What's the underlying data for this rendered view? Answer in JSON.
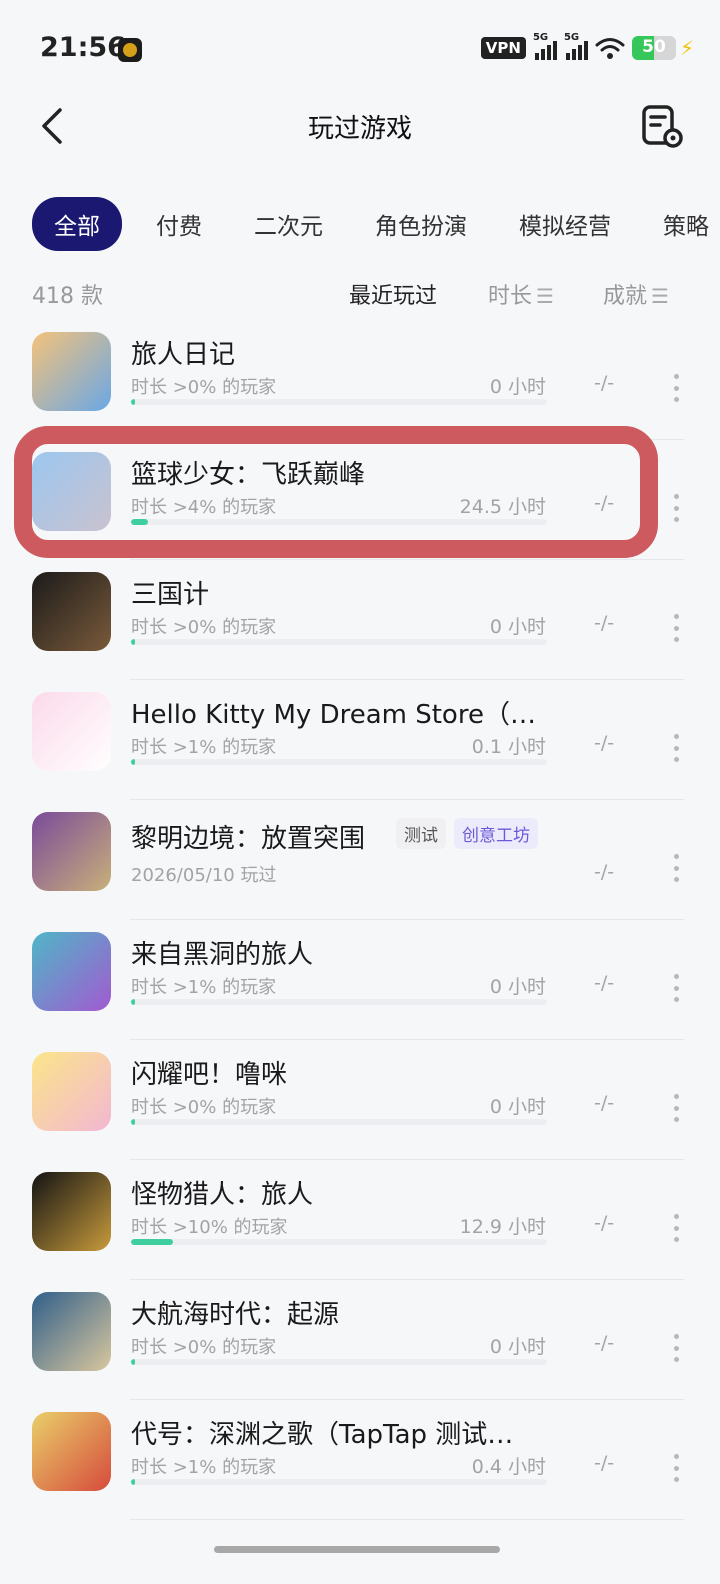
{
  "status": {
    "time": "21:56",
    "vpn": "VPN",
    "sig1": "5G",
    "sig2": "5G",
    "battery": "50"
  },
  "header": {
    "title": "玩过游戏"
  },
  "tabs": [
    "全部",
    "付费",
    "二次元",
    "角色扮演",
    "模拟经营",
    "策略"
  ],
  "sortbar": {
    "count": "418 款",
    "recent": "最近玩过",
    "duration": "时长",
    "achievement": "成就"
  },
  "games": [
    {
      "name": "旅人日记",
      "sub": "时长 >0% 的玩家",
      "hours": "0 小时",
      "ach": "-/-",
      "progress": 0.01,
      "icon": "game-icon-traveler-diary",
      "colors": [
        "#f4c27a",
        "#6aa7e6"
      ]
    },
    {
      "name": "篮球少女：飞跃巅峰",
      "sub": "时长 >4% 的玩家",
      "hours": "24.5 小时",
      "ach": "-/-",
      "progress": 0.04,
      "icon": "game-icon-basketball-girls",
      "colors": [
        "#9cc7f0",
        "#c9c2cf"
      ]
    },
    {
      "name": "三国计",
      "sub": "时长 >0% 的玩家",
      "hours": "0 小时",
      "ach": "-/-",
      "progress": 0.01,
      "icon": "game-icon-three-kingdoms",
      "colors": [
        "#1b1b1b",
        "#7a5a3a"
      ]
    },
    {
      "name": "Hello Kitty My Dream Store（…",
      "sub": "时长 >1% 的玩家",
      "hours": "0.1 小时",
      "ach": "-/-",
      "progress": 0.01,
      "icon": "game-icon-hello-kitty",
      "colors": [
        "#fbd9ea",
        "#ffffff"
      ]
    },
    {
      "name": "黎明边境：放置突围",
      "sub": "2026/05/10 玩过",
      "hours": "",
      "ach": "-/-",
      "progress": null,
      "badges": [
        "测试",
        "创意工坊"
      ],
      "icon": "game-icon-dawn-frontier",
      "colors": [
        "#7a4b9a",
        "#c8b07a"
      ]
    },
    {
      "name": "来自黑洞的旅人",
      "sub": "时长 >1% 的玩家",
      "hours": "0 小时",
      "ach": "-/-",
      "progress": 0.01,
      "icon": "game-icon-blackhole-traveler",
      "colors": [
        "#4fb6c7",
        "#a25ad0"
      ]
    },
    {
      "name": "闪耀吧！噜咪",
      "sub": "时长 >0% 的玩家",
      "hours": "0 小时",
      "ach": "-/-",
      "progress": 0.01,
      "icon": "game-icon-shine-lumi",
      "colors": [
        "#fbe58a",
        "#f3b7d2"
      ]
    },
    {
      "name": "怪物猎人：旅人",
      "sub": "时长 >10% 的玩家",
      "hours": "12.9 小时",
      "ach": "-/-",
      "progress": 0.1,
      "icon": "game-icon-monster-hunter",
      "colors": [
        "#141414",
        "#c89b3c"
      ]
    },
    {
      "name": "大航海时代：起源",
      "sub": "时长 >0% 的玩家",
      "hours": "0 小时",
      "ach": "-/-",
      "progress": 0.01,
      "icon": "game-icon-uncharted-waters",
      "colors": [
        "#2f5f8a",
        "#d9c79e"
      ]
    },
    {
      "name": "代号：深渊之歌（TapTap 测试…",
      "sub": "时长 >1% 的玩家",
      "hours": "0.4 小时",
      "ach": "-/-",
      "progress": 0.01,
      "icon": "game-icon-abyss-song",
      "colors": [
        "#e9cf6a",
        "#d64b3c"
      ]
    }
  ],
  "accent": {
    "active_tab_bg": "#1a1870",
    "progress": "#3fcf9f",
    "highlight": "#cc5a5f"
  }
}
